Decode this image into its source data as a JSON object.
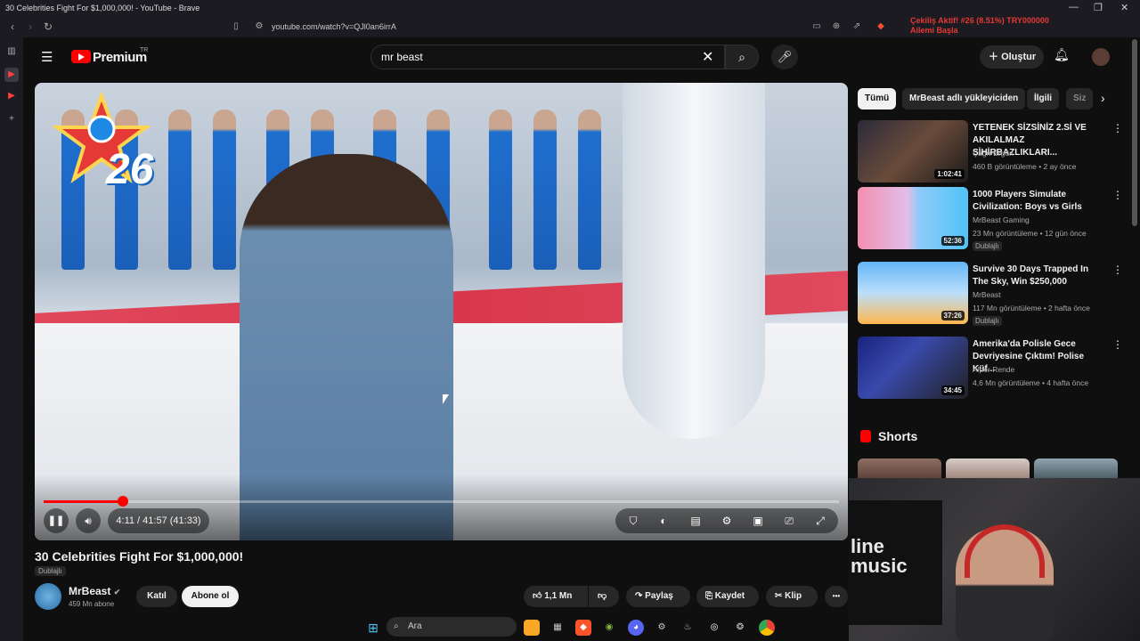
{
  "window": {
    "title": "30 Celebrities Fight For $1,000,000! - YouTube - Brave",
    "minimize_icon": "—",
    "maximize_icon": "❐",
    "close_icon": "✕"
  },
  "browser": {
    "url": "youtube.com/watch?v=QJl0an6irrA",
    "ticker_line1": "Çekiliş Aktif!   #26 (8.51%)   TRY000000",
    "ticker_line2": "Ailemi Başla"
  },
  "header": {
    "logo_text": "Premium",
    "logo_region": "TR",
    "search_value": "mr beast",
    "create_label": "Oluştur"
  },
  "player": {
    "overlay_number": "26",
    "time_display": "4:11 / 41:57 (41:33)",
    "progress_fraction": 0.0998
  },
  "video": {
    "title": "30 Celebrities Fight For $1,000,000!",
    "dub_label": "Dublajlı",
    "channel_name": "MrBeast",
    "subscribers": "459 Mn abone",
    "join_label": "Katıl",
    "subscribe_label": "Abone ol",
    "like_count": "1,1 Mn",
    "share_label": "Paylaş",
    "save_label": "Kaydet",
    "clip_label": "Klip",
    "more_icon": "•••"
  },
  "sidebar": {
    "chips": [
      "Tümü",
      "MrBeast adlı yükleyiciden",
      "İlgili",
      "Siz"
    ],
    "videos": [
      {
        "title": "YETENEK SİZSİNİZ 2.Sİ VE AKILALMAZ SİHİRBAZLIKLARI...",
        "channel": "Çağrı Ergün",
        "meta": "460 B görüntüleme • 2 ay önce",
        "duration": "1:02:41",
        "dubbed": ""
      },
      {
        "title": "1000 Players Simulate Civilization: Boys vs Girls",
        "channel": "MrBeast Gaming",
        "meta": "23 Mn görüntüleme • 12 gün önce",
        "duration": "52:36",
        "dubbed": "Dublajlı"
      },
      {
        "title": "Survive 30 Days Trapped In The Sky, Win $250,000",
        "channel": "MrBeast",
        "meta": "117 Mn görüntüleme • 2 hafta önce",
        "duration": "37:26",
        "dubbed": "Dublajlı"
      },
      {
        "title": "Amerika'da Polisle Gece Devriyesine Çıktım! Polise Küf...",
        "channel": "Alper Rende",
        "meta": "4,6 Mn görüntüleme • 4 hafta önce",
        "duration": "34:45",
        "dubbed": ""
      }
    ],
    "shorts_label": "Shorts"
  },
  "webcam": {
    "sign_text_1": "line",
    "sign_text_2": "music"
  },
  "taskbar": {
    "search_placeholder": "Ara"
  },
  "colors": {
    "accent": "#ff0000",
    "bg": "#0f0f0f",
    "chip_bg": "#272727"
  }
}
